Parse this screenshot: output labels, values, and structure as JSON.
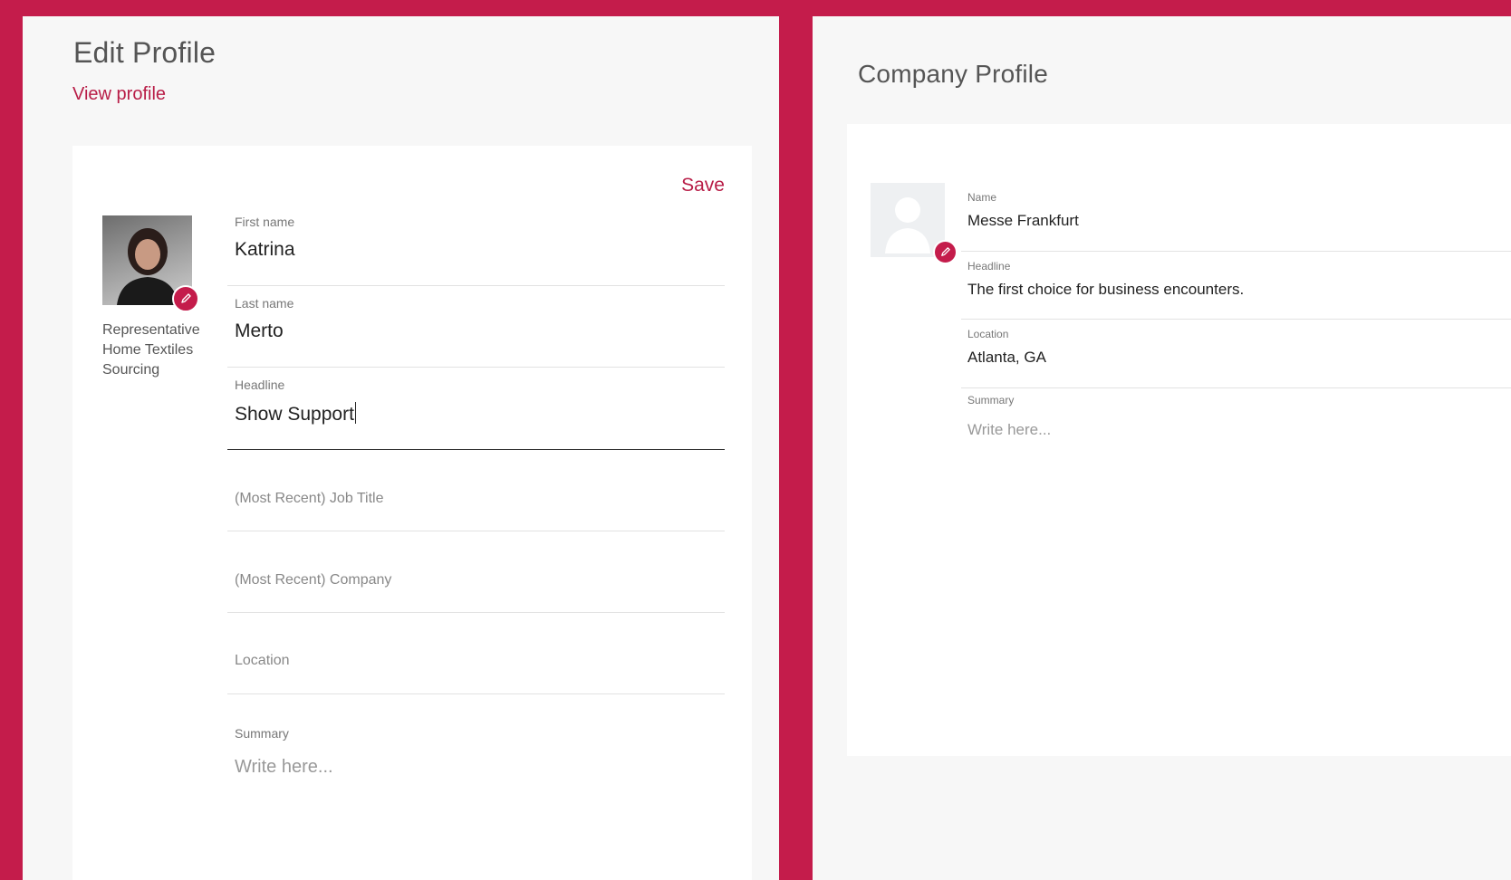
{
  "edit_profile": {
    "title": "Edit Profile",
    "view_profile_link": "View profile",
    "save_label": "Save",
    "role_lines": [
      "Representative",
      "Home Textiles",
      "Sourcing"
    ],
    "fields": {
      "first_name": {
        "label": "First name",
        "value": "Katrina"
      },
      "last_name": {
        "label": "Last name",
        "value": "Merto"
      },
      "headline": {
        "label": "Headline",
        "value": "Show Support"
      },
      "job_title": {
        "placeholder": "(Most Recent) Job Title"
      },
      "company": {
        "placeholder": "(Most Recent) Company"
      },
      "location": {
        "placeholder": "Location"
      },
      "summary": {
        "label": "Summary",
        "placeholder": "Write here..."
      }
    },
    "icons": {
      "avatar_edit": "pencil-icon"
    }
  },
  "company_profile": {
    "title": "Company Profile",
    "fields": {
      "name": {
        "label": "Name",
        "value": "Messe Frankfurt"
      },
      "headline": {
        "label": "Headline",
        "value": "The first choice for business encounters."
      },
      "location": {
        "label": "Location",
        "value": "Atlanta, GA"
      },
      "summary": {
        "label": "Summary",
        "placeholder": "Write here..."
      }
    },
    "icons": {
      "logo_placeholder": "user-silhouette-icon",
      "logo_edit": "pencil-icon"
    }
  },
  "colors": {
    "accent": "#c41c4b",
    "link": "#b81d47",
    "panel_bg": "#f7f7f7",
    "card_bg": "#ffffff"
  }
}
